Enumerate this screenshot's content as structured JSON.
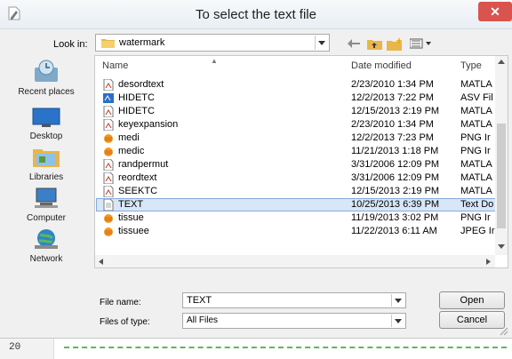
{
  "window": {
    "title": "To select the text file",
    "close_glyph": "✕"
  },
  "lookin": {
    "label": "Look in:",
    "value": "watermark"
  },
  "sidebar": {
    "items": [
      {
        "label": "Recent places",
        "icon": "recent-places-icon"
      },
      {
        "label": "Desktop",
        "icon": "desktop-icon"
      },
      {
        "label": "Libraries",
        "icon": "libraries-icon"
      },
      {
        "label": "Computer",
        "icon": "computer-icon"
      },
      {
        "label": "Network",
        "icon": "network-icon"
      }
    ]
  },
  "columns": {
    "name": "Name",
    "date": "Date modified",
    "type": "Type"
  },
  "files": [
    {
      "name": "desordtext",
      "date": "2/23/2010 1:34 PM",
      "type": "MATLA",
      "icon": "m-file"
    },
    {
      "name": "HIDETC",
      "date": "12/2/2013 7:22 PM",
      "type": "ASV Fil",
      "icon": "asv-file"
    },
    {
      "name": "HIDETC",
      "date": "12/15/2013 2:19 PM",
      "type": "MATLA",
      "icon": "m-file"
    },
    {
      "name": "keyexpansion",
      "date": "2/23/2010 1:34 PM",
      "type": "MATLA",
      "icon": "m-file"
    },
    {
      "name": "medi",
      "date": "12/2/2013 7:23 PM",
      "type": "PNG Ir",
      "icon": "image-file"
    },
    {
      "name": "medic",
      "date": "11/21/2013 1:18 PM",
      "type": "PNG Ir",
      "icon": "image-file"
    },
    {
      "name": "randpermut",
      "date": "3/31/2006 12:09 PM",
      "type": "MATLA",
      "icon": "m-file"
    },
    {
      "name": "reordtext",
      "date": "3/31/2006 12:09 PM",
      "type": "MATLA",
      "icon": "m-file"
    },
    {
      "name": "SEEKTC",
      "date": "12/15/2013 2:19 PM",
      "type": "MATLA",
      "icon": "m-file"
    },
    {
      "name": "TEXT",
      "date": "10/25/2013 6:39 PM",
      "type": "Text Do",
      "icon": "text-file",
      "selected": true
    },
    {
      "name": "tissue",
      "date": "11/19/2013 3:02 PM",
      "type": "PNG Ir",
      "icon": "image-file"
    },
    {
      "name": "tissuee",
      "date": "11/22/2013 6:11 AM",
      "type": "JPEG Ir",
      "icon": "image-file"
    }
  ],
  "filename": {
    "label": "File name:",
    "value": "TEXT"
  },
  "filetype": {
    "label": "Files of type:",
    "value": "All Files"
  },
  "buttons": {
    "open": "Open",
    "cancel": "Cancel"
  },
  "editor": {
    "line_number": "20"
  },
  "colors": {
    "selection": "#d8e6f7",
    "close": "#d9534f",
    "folder": "#e8b64a",
    "dash": "#5cb85c"
  }
}
